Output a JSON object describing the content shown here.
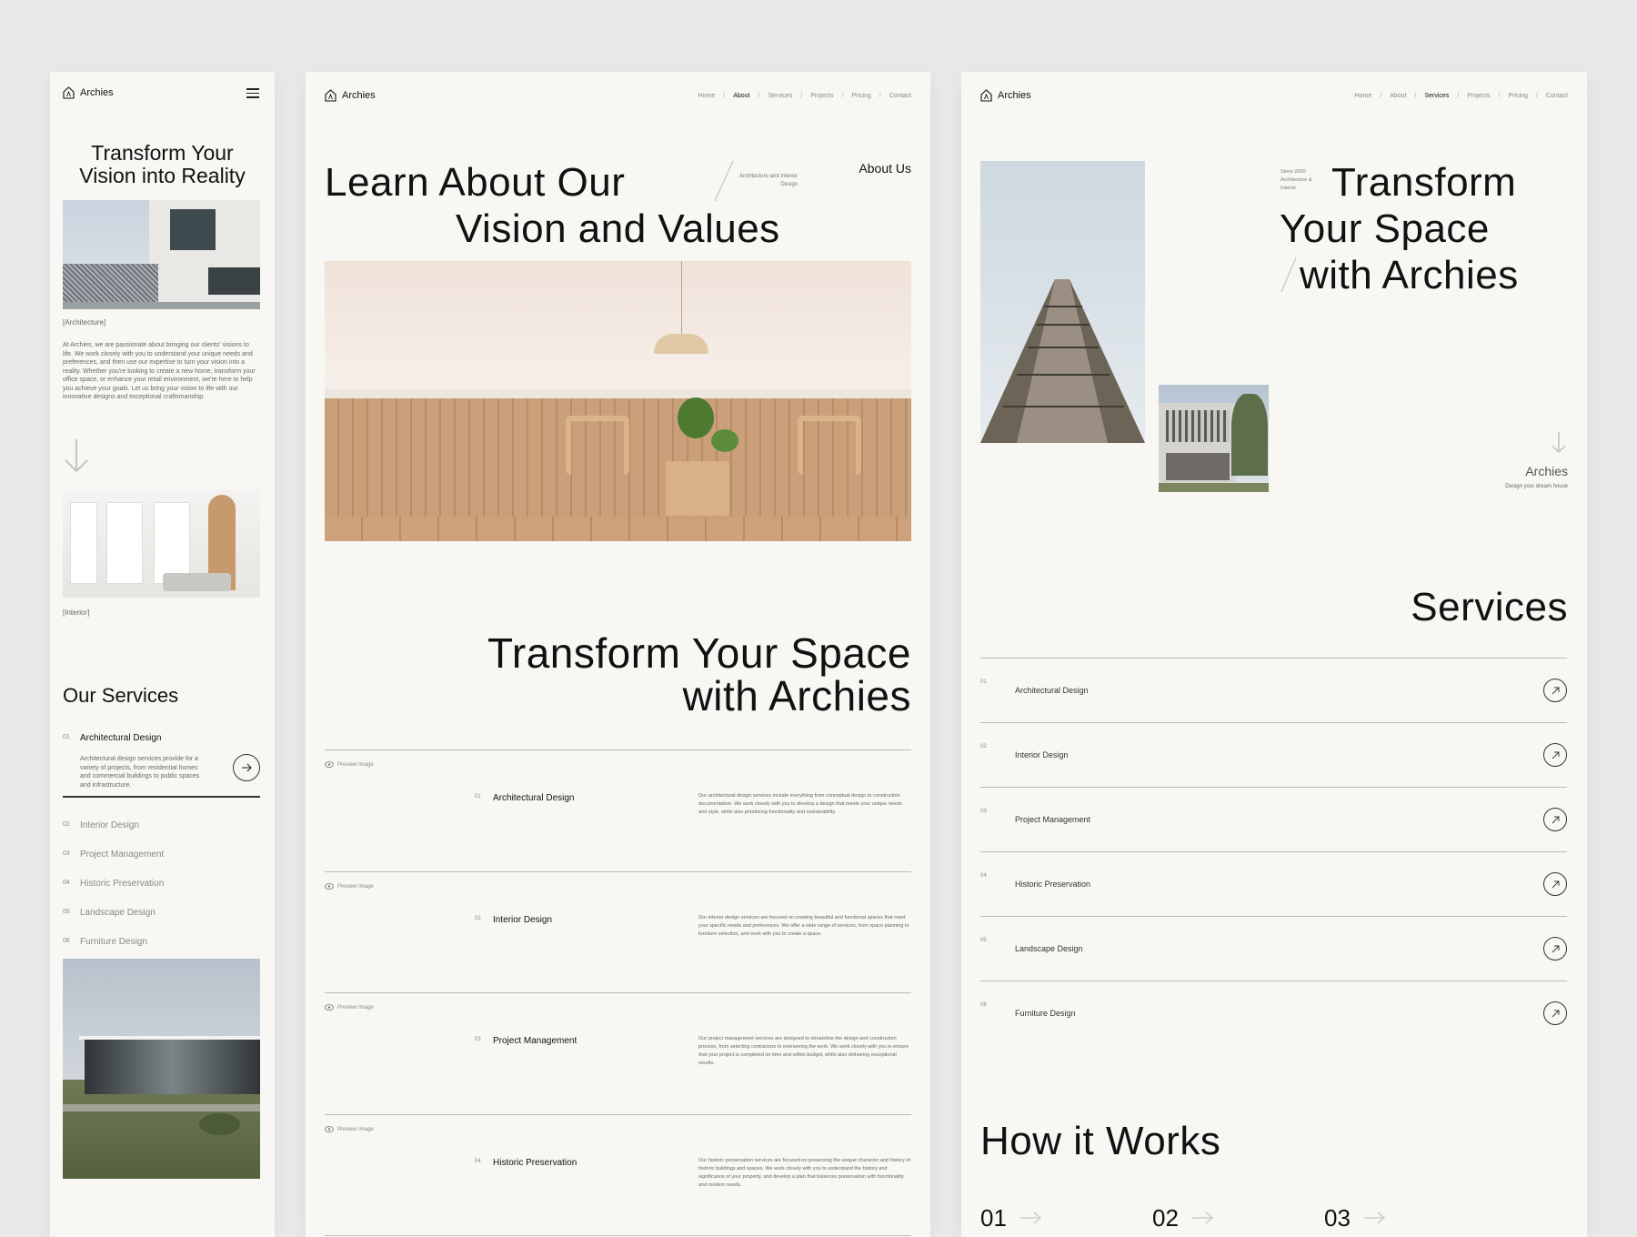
{
  "brand": "Archies",
  "mobile": {
    "hero_title_1": "Transform Your",
    "hero_title_2": "Vision into Reality",
    "caption_architecture": "[Architecture]",
    "intro": "At Archies, we are passionate about bringing our clients' visions to life. We work closely with you to understand your unique needs and preferences, and then use our expertise to turn your vision into a reality. Whether you're looking to create a new home, transform your office space, or enhance your retail environment, we're here to help you achieve your goals. Let us bring your vision to life with our innovative designs and exceptional craftsmanship.",
    "caption_interior": "[Interior]",
    "services_title": "Our Services",
    "active_service": {
      "num": "01",
      "name": "Architectural Design",
      "desc": "Architectural design services provide for a variety of projects, from residential homes and commercial buildings to public spaces and infrastructure."
    },
    "services": [
      {
        "num": "02",
        "name": "Interior Design"
      },
      {
        "num": "03",
        "name": "Project Management"
      },
      {
        "num": "04",
        "name": "Historic Preservation"
      },
      {
        "num": "05",
        "name": "Landscape Design"
      },
      {
        "num": "06",
        "name": "Furniture Design"
      }
    ]
  },
  "about": {
    "nav": [
      "Home",
      "About",
      "Services",
      "Projects",
      "Pricing",
      "Contact"
    ],
    "hero_line_1": "Learn About Our",
    "hero_line_2": "Vision and Values",
    "tag": "Architecture and Interior Design",
    "about_us": "About Us",
    "section_line_1": "Transform Your Space",
    "section_line_2": "with Archies",
    "preview_label": "Preview Image",
    "services": [
      {
        "num": "01",
        "name": "Architectural Design",
        "desc": "Our architectural design services include everything from conceptual design to construction documentation. We work closely with you to develop a design that meets your unique needs and style, while also prioritizing functionality and sustainability."
      },
      {
        "num": "02",
        "name": "Interior Design",
        "desc": "Our interior design services are focused on creating beautiful and functional spaces that meet your specific needs and preferences. We offer a wide range of services, from space planning to furniture selection, and work with you to create a space."
      },
      {
        "num": "03",
        "name": "Project Management",
        "desc": "Our project management services are designed to streamline the design and construction process, from selecting contractors to overseeing the work. We work closely with you to ensure that your project is completed on time and within budget, while also delivering exceptional results."
      },
      {
        "num": "04",
        "name": "Historic Preservation",
        "desc": "Our historic preservation services are focused on preserving the unique character and history of historic buildings and spaces. We work closely with you to understand the history and significance of your property, and develop a plan that balances preservation with functionality and modern needs."
      }
    ]
  },
  "services_page": {
    "nav": [
      "Home",
      "About",
      "Services",
      "Projects",
      "Pricing",
      "Contact"
    ],
    "since": "Since 2000 Architecture & Interior",
    "hero_line_1": "Transform",
    "hero_line_2": "Your Space",
    "hero_line_3": "with Archies",
    "brand_label": "Archies",
    "brand_sub": "Design your dream house",
    "services_title": "Services",
    "services": [
      {
        "num": "01",
        "name": "Architectural Design"
      },
      {
        "num": "02",
        "name": "Interior Design"
      },
      {
        "num": "03",
        "name": "Project Management"
      },
      {
        "num": "04",
        "name": "Historic Preservation"
      },
      {
        "num": "05",
        "name": "Landscape Design"
      },
      {
        "num": "06",
        "name": "Furniture Design"
      }
    ],
    "how_title": "How it Works",
    "steps": [
      "01",
      "02",
      "03"
    ]
  }
}
